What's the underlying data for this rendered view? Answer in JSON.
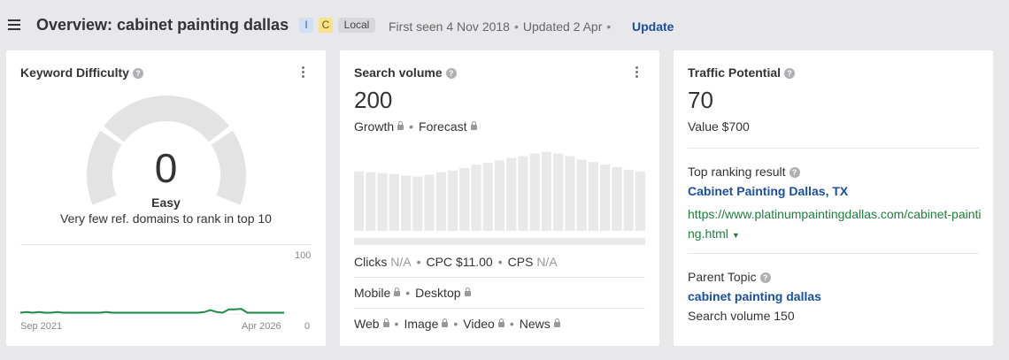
{
  "header": {
    "title": "Overview: cabinet painting dallas",
    "badges": {
      "intent_i": "I",
      "intent_c": "C",
      "local": "Local"
    },
    "first_seen": "First seen 4 Nov 2018",
    "updated": "Updated 2 Apr",
    "update_label": "Update",
    "separator": "•"
  },
  "keyword_difficulty": {
    "title": "Keyword Difficulty",
    "value": "0",
    "label": "Easy",
    "description": "Very few ref. domains to rank in top 10",
    "axis_max": "100",
    "axis_min": "0",
    "date_start": "Sep 2021",
    "date_end": "Apr 2026",
    "series": [
      2,
      3,
      2,
      3,
      2,
      2,
      3,
      2,
      2,
      2,
      2,
      2,
      2,
      2,
      3,
      2,
      2,
      2,
      2,
      2,
      2,
      2,
      2,
      2,
      2,
      2,
      2,
      2,
      2,
      2,
      3,
      6,
      3,
      2,
      7,
      7,
      8,
      2,
      2,
      2,
      2,
      2,
      2,
      2
    ],
    "colors": {
      "gauge": "#e3e3e3",
      "line": "#1e8a4c"
    }
  },
  "search_volume": {
    "title": "Search volume",
    "value": "200",
    "growth_label": "Growth",
    "forecast_label": "Forecast",
    "bars": [
      70,
      69,
      68,
      67,
      65,
      64,
      66,
      69,
      71,
      74,
      78,
      80,
      83,
      86,
      88,
      91,
      93,
      91,
      88,
      84,
      81,
      78,
      75,
      72,
      70
    ],
    "clicks_label": "Clicks",
    "clicks_value": "N/A",
    "cpc_label": "CPC",
    "cpc_value": "$11.00",
    "cps_label": "CPS",
    "cps_value": "N/A",
    "mobile_label": "Mobile",
    "desktop_label": "Desktop",
    "web_label": "Web",
    "image_label": "Image",
    "video_label": "Video",
    "news_label": "News",
    "colors": {
      "bar": "#e9e9ea"
    }
  },
  "traffic_potential": {
    "title": "Traffic Potential",
    "value": "70",
    "value_text": "Value $700",
    "top_ranking_label": "Top ranking result",
    "top_ranking_title": "Cabinet Painting Dallas, TX",
    "top_ranking_url": "https://www.platinumpaintingdallas.com/cabinet-painting.html",
    "parent_topic_label": "Parent Topic",
    "parent_topic_value": "cabinet painting dallas",
    "parent_topic_volume": "Search volume 150"
  },
  "icons": {
    "menu": "hamburger-icon",
    "help": "question-circle-icon",
    "more": "kebab-vertical-icon",
    "lock": "lock-icon",
    "dropdown": "caret-down-icon"
  },
  "colors": {
    "link": "#1a4fa0",
    "url": "#1e7f3c",
    "badge_i": "#cfe0f5",
    "badge_c": "#f9e08a"
  }
}
